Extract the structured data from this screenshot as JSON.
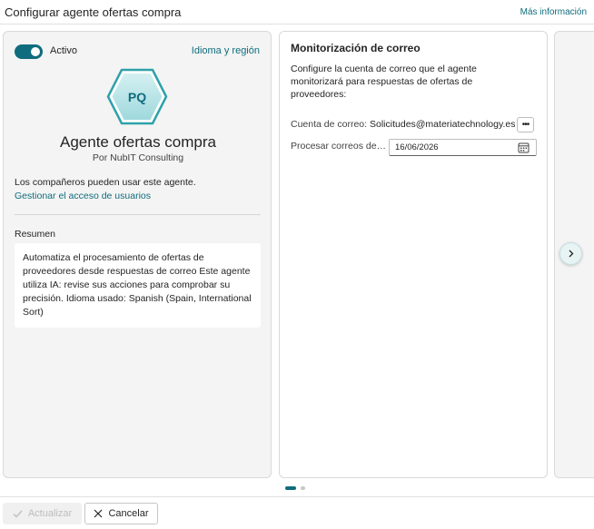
{
  "header": {
    "title": "Configurar agente ofertas compra",
    "more_info": "Más información"
  },
  "left_card": {
    "toggle_label": "Activo",
    "toggle_on": true,
    "lang_link": "Idioma y región",
    "avatar_initials": "PQ",
    "agent_name": "Agente ofertas compra",
    "agent_by": "Por NubIT Consulting",
    "share_text": "Los compañeros pueden usar este agente.",
    "manage_link": "Gestionar el acceso de usuarios",
    "summary_label": "Resumen",
    "summary_text": "Automatiza el procesamiento de ofertas de proveedores desde respuestas de correo Este agente utiliza IA: revise sus acciones para comprobar su precisión. Idioma usado: Spanish (Spain, International Sort)"
  },
  "mid_card": {
    "title": "Monitorización de correo",
    "description": "Configure la cuenta de correo que el agente monitorizará para respuestas de ofertas de proveedores:",
    "email_label": "Cuenta de correo:",
    "email_value": "Solicitudes@materiatechnology.es",
    "date_label": "Procesar correos desde",
    "date_value": "16/06/2026"
  },
  "footer": {
    "update_label": "Actualizar",
    "cancel_label": "Cancelar"
  },
  "colors": {
    "accent": "#0f6c7e",
    "hex_fill": "#b4e4e6"
  },
  "pager": {
    "pages": 2,
    "current": 1
  }
}
